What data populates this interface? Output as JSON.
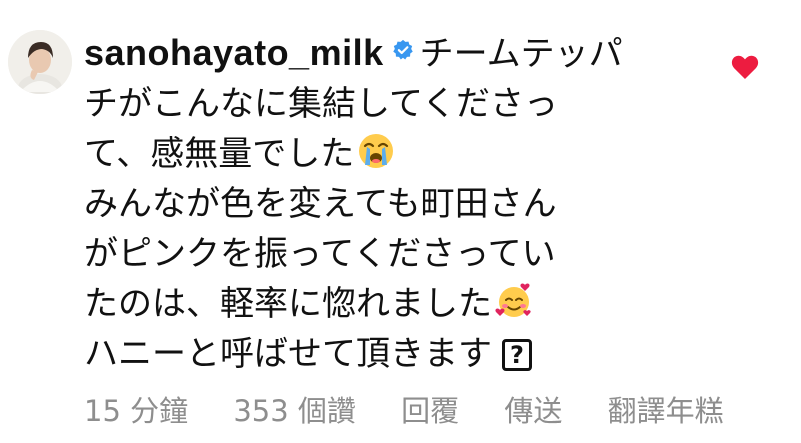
{
  "comment": {
    "username": "sanohayato_milk",
    "verified_icon": "verified-badge-icon",
    "lines": [
      "チームテッパ",
      "チがこんなに集結してくださっ",
      "て、感無量でした",
      "みんなが色を変えても町田さん",
      "がピンクを振ってくださってい",
      "たのは、軽率に惚れました",
      "ハニーと呼ばせて頂きます"
    ],
    "emojis": [
      "loudly-crying-face-emoji",
      "smiling-face-with-hearts-emoji",
      "question-box-glyph"
    ],
    "question_glyph": "?",
    "like_icon": "heart-icon",
    "accent_color": "#ed1c40",
    "verified_color": "#3897f0"
  },
  "actions": {
    "time": "15 分鐘",
    "likes": "353 個讚",
    "reply": "回覆",
    "send": "傳送",
    "translate": "翻譯年糕"
  }
}
